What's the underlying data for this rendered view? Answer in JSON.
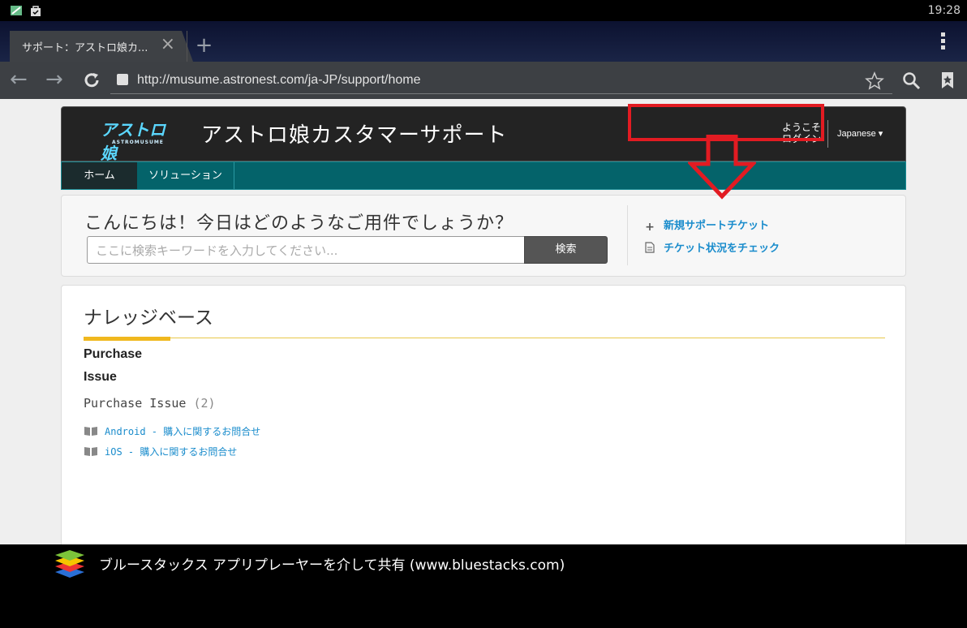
{
  "status_bar": {
    "time": "19:28"
  },
  "browser": {
    "tab_title": "サポート：アストロ娘カ...",
    "url": "http://musume.astronest.com/ja-JP/support/home"
  },
  "site": {
    "logo_text": "アストロ娘",
    "logo_sub": "ASTROMUSUME",
    "title": "アストロ娘カスタマーサポート",
    "welcome": "ようこそ",
    "login": "ログイン",
    "language": "Japanese ▾",
    "nav": {
      "home": "ホーム",
      "solutions": "ソリューション"
    }
  },
  "search": {
    "greeting": "こんにちは！今日はどのようなご用件でしょうか？",
    "placeholder": "ここに検索キーワードを入力してください...",
    "button": "検索",
    "new_ticket": "新規サポートチケット",
    "check_ticket": "チケット状況をチェック"
  },
  "knowledge_base": {
    "title": "ナレッジベース",
    "category_line1": "Purchase",
    "category_line2": "Issue",
    "subcategory": "Purchase Issue",
    "subcategory_count": "(2)",
    "articles": [
      "Android - 購入に関するお問合せ",
      "iOS - 購入に関するお問合せ"
    ]
  },
  "footer": {
    "share_text": "ブルースタックス アプリプレーヤーを介して共有 (www.bluestacks.com)"
  },
  "colors": {
    "nav_teal": "#04636a",
    "link_blue": "#1a8ccc",
    "highlight_red": "#e21b22",
    "accent_gold": "#f0b81e"
  }
}
